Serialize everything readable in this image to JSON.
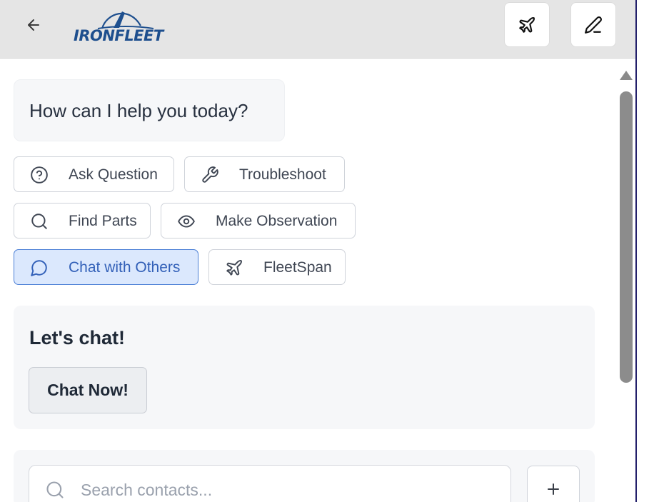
{
  "header": {
    "logo_text": "IRONFLEET",
    "icons": {
      "back": "arrow-left-icon",
      "plane": "plane-icon",
      "edit": "pencil-icon"
    }
  },
  "greeting": "How can I help you today?",
  "quick_actions": [
    {
      "label": "Ask Question",
      "icon": "help-circle-icon",
      "active": false
    },
    {
      "label": "Troubleshoot",
      "icon": "wrench-icon",
      "active": false
    },
    {
      "label": "Find Parts",
      "icon": "search-icon",
      "active": false
    },
    {
      "label": "Make Observation",
      "icon": "eye-icon",
      "active": false
    },
    {
      "label": "Chat with Others",
      "icon": "chat-bubble-icon",
      "active": true
    },
    {
      "label": "FleetSpan",
      "icon": "plane-icon",
      "active": false
    }
  ],
  "chat_card": {
    "title": "Let's chat!",
    "button_label": "Chat Now!"
  },
  "contacts": {
    "search_placeholder": "Search contacts...",
    "add_icon": "plus-icon"
  },
  "colors": {
    "brand": "#1e4f8e",
    "active_bg": "#dbe8fd",
    "active_border": "#4b7fd6",
    "header_bg": "#e5e5e5"
  }
}
